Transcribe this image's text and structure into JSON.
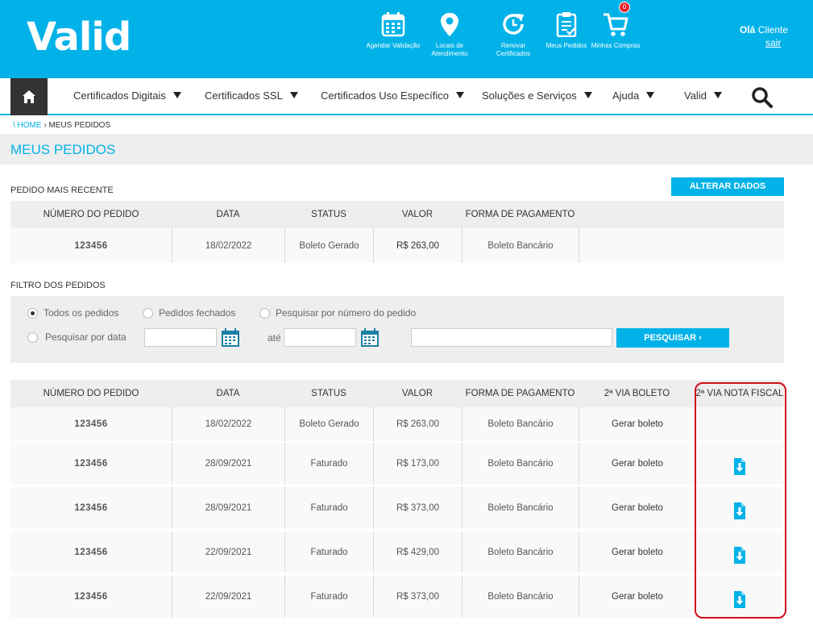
{
  "header": {
    "logo": "Valid",
    "icons": [
      {
        "icon": "calendar-icon",
        "label": "Agendar Validação"
      },
      {
        "icon": "location-pin-icon",
        "label": "Locais de Atendimento"
      },
      {
        "icon": "renew-clock-icon",
        "label": "Renovar Certificados"
      },
      {
        "icon": "clipboard-icon",
        "label": "Meus Pedidos"
      },
      {
        "icon": "cart-icon",
        "label": "Minhas Compras",
        "badge": "0"
      }
    ],
    "greeting_bold": "Olá",
    "greeting_name": "Cliente",
    "logout": "sair"
  },
  "nav": {
    "items": [
      "Certificados Digitais",
      "Certificados SSL",
      "Certificados Uso Específico",
      "Soluções e Serviços",
      "Ajuda",
      "Valid"
    ]
  },
  "breadcrumb": {
    "home": "\\ HOME",
    "sep": " › ",
    "current": "MEUS PEDIDOS"
  },
  "page_title": "MEUS PEDIDOS",
  "recent": {
    "label": "PEDIDO MAIS RECENTE",
    "alter_button": "ALTERAR DADOS",
    "headers": [
      "NÚMERO DO PEDIDO",
      "DATA",
      "STATUS",
      "VALOR",
      "FORMA DE PAGAMENTO"
    ],
    "row": {
      "pedido": "123456",
      "data": "18/02/2022",
      "status": "Boleto Gerado",
      "valor": "R$ 263,00",
      "pagamento": "Boleto Bancário"
    }
  },
  "filter": {
    "label": "FILTRO DOS PEDIDOS",
    "opt_all": "Todos os pedidos",
    "opt_closed": "Pedidos fechados",
    "opt_number": "Pesquisar por número do pedido",
    "opt_date": "Pesquisar por data",
    "selected": "Todos os pedidos",
    "ate": "até",
    "search_button": "PESQUISAR ›",
    "date_from": "",
    "date_to": "",
    "order_number": ""
  },
  "orders": {
    "headers": [
      "NÚMERO DO PEDIDO",
      "DATA",
      "STATUS",
      "VALOR",
      "FORMA DE PAGAMENTO",
      "2ª VIA BOLETO",
      "2ª VIA NOTA FISCAL"
    ],
    "rows": [
      {
        "pedido": "123456",
        "data": "18/02/2022",
        "status": "Boleto Gerado",
        "valor": "R$ 263,00",
        "pagamento": "Boleto Bancário",
        "boleto": "Gerar boleto",
        "nota": false
      },
      {
        "pedido": "123456",
        "data": "28/09/2021",
        "status": "Faturado",
        "valor": "R$ 173,00",
        "pagamento": "Boleto Bancário",
        "boleto": "Gerar boleto",
        "nota": true
      },
      {
        "pedido": "123456",
        "data": "28/09/2021",
        "status": "Faturado",
        "valor": "R$ 373,00",
        "pagamento": "Boleto Bancário",
        "boleto": "Gerar boleto",
        "nota": true
      },
      {
        "pedido": "123456",
        "data": "22/09/2021",
        "status": "Faturado",
        "valor": "R$ 429,00",
        "pagamento": "Boleto Bancário",
        "boleto": "Gerar boleto",
        "nota": true
      },
      {
        "pedido": "123456",
        "data": "22/09/2021",
        "status": "Faturado",
        "valor": "R$ 373,00",
        "pagamento": "Boleto Bancário",
        "boleto": "Gerar boleto",
        "nota": true
      }
    ]
  },
  "colors": {
    "brand": "#00b2e8",
    "highlight": "#d0101b",
    "header_bg": "#eeeeee"
  }
}
